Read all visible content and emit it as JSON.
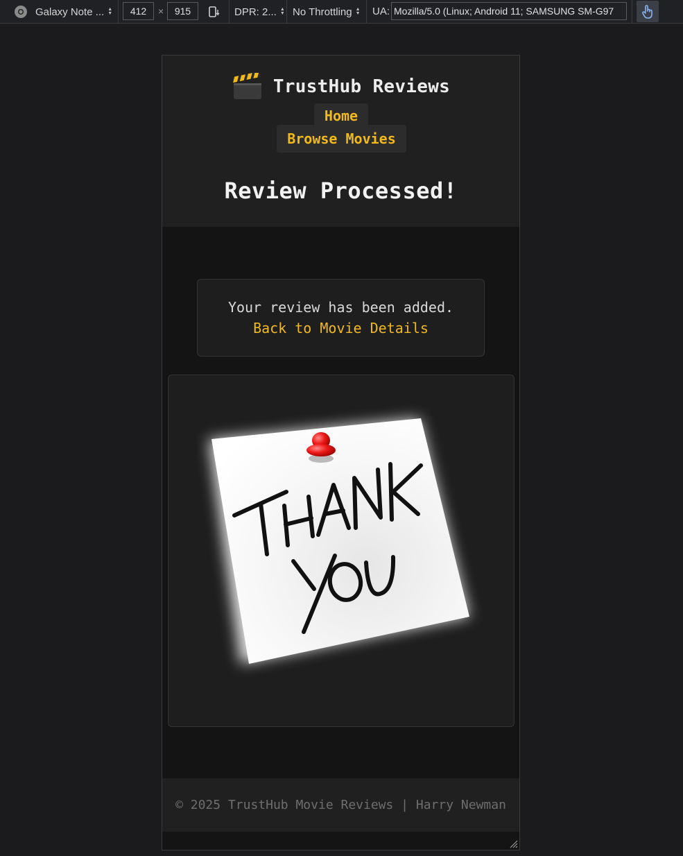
{
  "devtools": {
    "device_name": "Galaxy Note ...",
    "width": "412",
    "times": "×",
    "height": "915",
    "dpr": "DPR: 2...",
    "throttling": "No Throttling",
    "ua_label": "UA:",
    "ua_value": "Mozilla/5.0 (Linux; Android 11; SAMSUNG SM-G97"
  },
  "site": {
    "brand_icon": "clapperboard-icon",
    "brand_name": "TrustHub Reviews",
    "nav": {
      "home": "Home",
      "browse": "Browse Movies"
    },
    "page_title": "Review Processed!"
  },
  "message": {
    "text": "Your review has been added.",
    "link": "Back to Movie Details"
  },
  "image": {
    "line1": "THANK",
    "line2": "YOU"
  },
  "footer": {
    "text": "© 2025 TrustHub Movie Reviews | Harry Newman"
  },
  "colors": {
    "accent": "#f1b91b",
    "page_bg": "#141414",
    "header_bg": "#202020",
    "card_bg": "#1e1e1e"
  }
}
